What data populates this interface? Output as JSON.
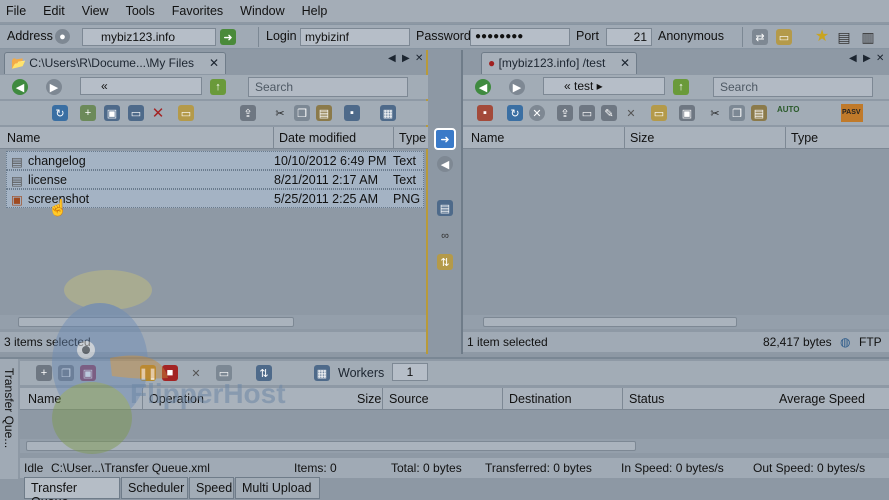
{
  "menu": [
    "File",
    "Edit",
    "View",
    "Tools",
    "Favorites",
    "Window",
    "Help"
  ],
  "address": {
    "label": "Address",
    "value": "mybiz123.info",
    "login_label": "Login",
    "login": "mybizinf",
    "password_label": "Password",
    "password": "●●●●●●●●",
    "port_label": "Port",
    "port": "21",
    "anonymous": "Anonymous"
  },
  "left": {
    "tab": "C:\\Users\\R\\Docume...\\My Files",
    "path": "«",
    "search_placeholder": "Search",
    "columns": [
      "Name",
      "Date modified",
      "Type"
    ],
    "files": [
      {
        "name": "changelog",
        "date": "10/10/2012 6:49 PM",
        "type": "Text"
      },
      {
        "name": "license",
        "date": "8/21/2011 2:17 AM",
        "type": "Text"
      },
      {
        "name": "screenshot",
        "date": "5/25/2011 2:25 AM",
        "type": "PNG"
      }
    ],
    "status": "3 items selected"
  },
  "right": {
    "tab": "[mybiz123.info] /test",
    "path": "«  test  ▸",
    "search_placeholder": "Search",
    "columns": [
      "Name",
      "Size",
      "Type"
    ],
    "status": "1 item selected",
    "bytes": "82,417",
    "bytes_label": "bytes",
    "protocol": "FTP",
    "pasv": "PASV",
    "auto": "AUTO"
  },
  "queue": {
    "side_label": "Transfer Que...",
    "workers_label": "Workers",
    "workers": "1",
    "columns": [
      "Name",
      "Operation",
      "Size",
      "Source",
      "Destination",
      "Status",
      "Average Speed"
    ],
    "status": {
      "state": "Idle",
      "file": "C:\\User...\\Transfer Queue.xml",
      "items": "Items: 0",
      "total": "Total: 0 bytes",
      "transferred": "Transferred: 0 bytes",
      "in_speed": "In Speed: 0 bytes/s",
      "out_speed": "Out Speed: 0 bytes/s"
    }
  },
  "bottom_tabs": [
    "Transfer Queue",
    "Scheduler",
    "Speed",
    "Multi Upload"
  ],
  "watermark": {
    "brand": "FlipperHost",
    "badge": "FLIPPER HOST"
  }
}
